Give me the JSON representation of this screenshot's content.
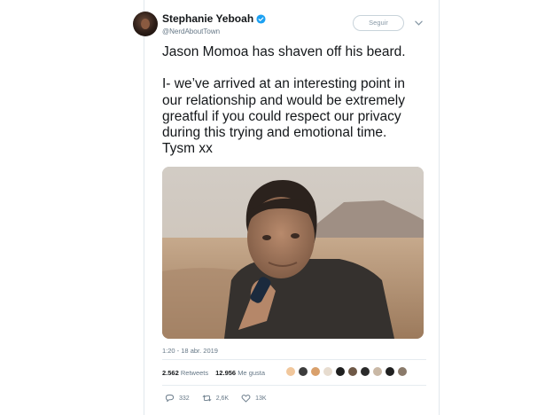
{
  "tweet": {
    "author": {
      "display_name": "Stephanie Yeboah",
      "handle": "@NerdAboutTown",
      "verified": true
    },
    "follow_label": "Seguir",
    "text_lines_1": [
      "Jason Momoa has shaven off his beard."
    ],
    "text_lines_2": [
      "I- we’ve arrived at an interesting point in",
      "our relationship and would be extremely",
      "greatful if you could respect our privacy",
      "during this trying and emotional time.",
      "Tysm xx"
    ],
    "timestamp": "1:20 - 18 abr. 2019",
    "stats": {
      "retweets_count": "2.562",
      "retweets_label": "Retweets",
      "likes_count": "12.956",
      "likes_label": "Me gusta"
    },
    "actions": {
      "reply_count": "332",
      "retweet_count": "2,6K",
      "like_count": "13K"
    },
    "icons": {
      "verified": "verified-badge-icon",
      "menu": "chevron-down-icon",
      "reply": "reply-icon",
      "retweet": "retweet-icon",
      "like": "heart-icon"
    },
    "colors": {
      "verified": "#1da1f2",
      "muted": "#657786",
      "text": "#14171a"
    }
  }
}
